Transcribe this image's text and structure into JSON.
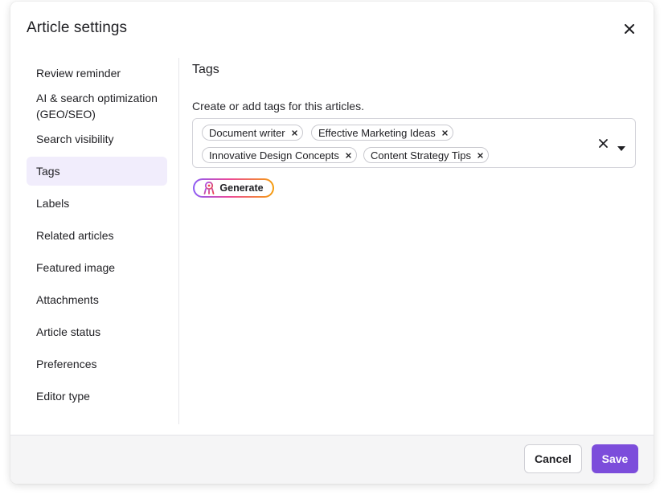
{
  "dialog": {
    "title": "Article settings"
  },
  "sidebar": {
    "items": [
      {
        "label": "Review reminder"
      },
      {
        "label": "AI & search optimization (GEO/SEO)"
      },
      {
        "label": "Search visibility"
      },
      {
        "label": "Tags",
        "active": true
      },
      {
        "label": "Labels"
      },
      {
        "label": "Related articles"
      },
      {
        "label": "Featured image"
      },
      {
        "label": "Attachments"
      },
      {
        "label": "Article status"
      },
      {
        "label": "Preferences"
      },
      {
        "label": "Editor type"
      }
    ]
  },
  "main": {
    "section_title": "Tags",
    "help_text": "Create or add tags for this articles.",
    "tags": [
      "Document writer",
      "Effective Marketing Ideas",
      "Innovative Design Concepts",
      "Content Strategy Tips"
    ],
    "generate_label": "Generate"
  },
  "footer": {
    "cancel_label": "Cancel",
    "save_label": "Save"
  },
  "colors": {
    "accent": "#7c4ddb",
    "active_bg": "#f1edfc"
  }
}
